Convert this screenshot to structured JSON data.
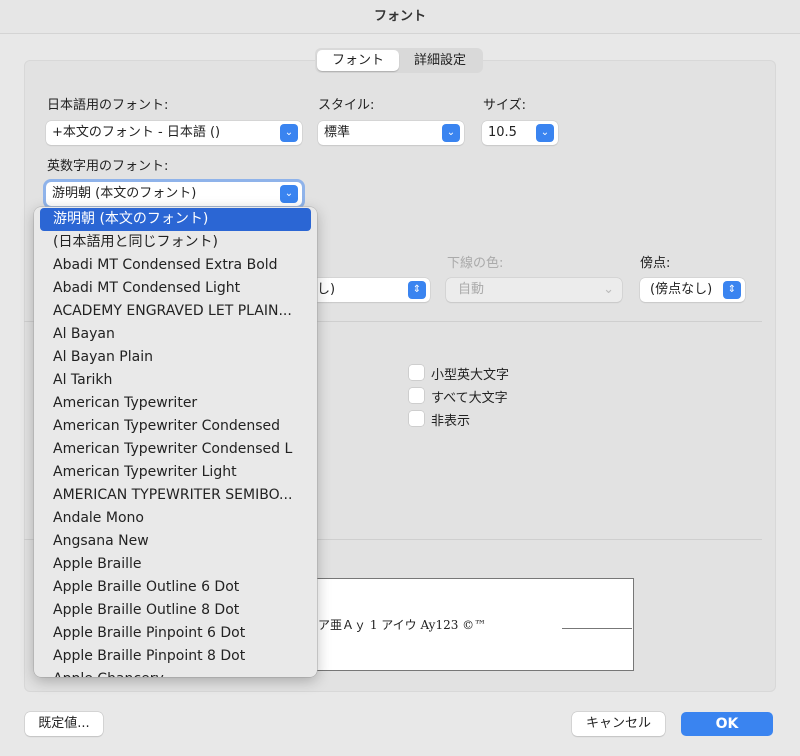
{
  "window": {
    "title": "フォント"
  },
  "tabs": [
    {
      "label": "フォント",
      "selected": true
    },
    {
      "label": "詳細設定",
      "selected": false
    }
  ],
  "japanese_font": {
    "label": "日本語用のフォント:",
    "value": "+本文のフォント - 日本語 ()"
  },
  "style": {
    "label": "スタイル:",
    "value": "標準"
  },
  "size": {
    "label": "サイズ:",
    "value": "10.5"
  },
  "latin_font": {
    "label": "英数字用のフォント:",
    "value": "游明朝 (本文のフォント)"
  },
  "underline": {
    "value_partial": "し)"
  },
  "underline_color": {
    "label": "下線の色:",
    "value": "自動"
  },
  "emphasis": {
    "label": "傍点:",
    "value": "(傍点なし)"
  },
  "effects": [
    {
      "label": "小型英大文字",
      "checked": false
    },
    {
      "label": "すべて大文字",
      "checked": false
    },
    {
      "label": "非表示",
      "checked": false
    }
  ],
  "preview": {
    "text": "ア亜Ａｙ 1 アイウ Ay123 ©™"
  },
  "font_menu": {
    "items": [
      "游明朝 (本文のフォント)",
      "(日本語用と同じフォント)",
      "Abadi MT Condensed Extra Bold",
      "Abadi MT Condensed Light",
      "ACADEMY ENGRAVED LET PLAIN...",
      "Al Bayan",
      "Al Bayan Plain",
      "Al Tarikh",
      "American Typewriter",
      "American Typewriter Condensed",
      "American Typewriter Condensed L",
      "American Typewriter Light",
      "AMERICAN TYPEWRITER SEMIBO...",
      "Andale Mono",
      "Angsana New",
      "Apple Braille",
      "Apple Braille Outline 6 Dot",
      "Apple Braille Outline 8 Dot",
      "Apple Braille Pinpoint 6 Dot",
      "Apple Braille Pinpoint 8 Dot",
      "Apple Chancery"
    ],
    "highlighted": 0
  },
  "buttons": {
    "default": "既定値...",
    "cancel": "キャンセル",
    "ok": "OK"
  },
  "colors": {
    "accent": "#3a84f0",
    "highlight": "#2b66d4"
  }
}
